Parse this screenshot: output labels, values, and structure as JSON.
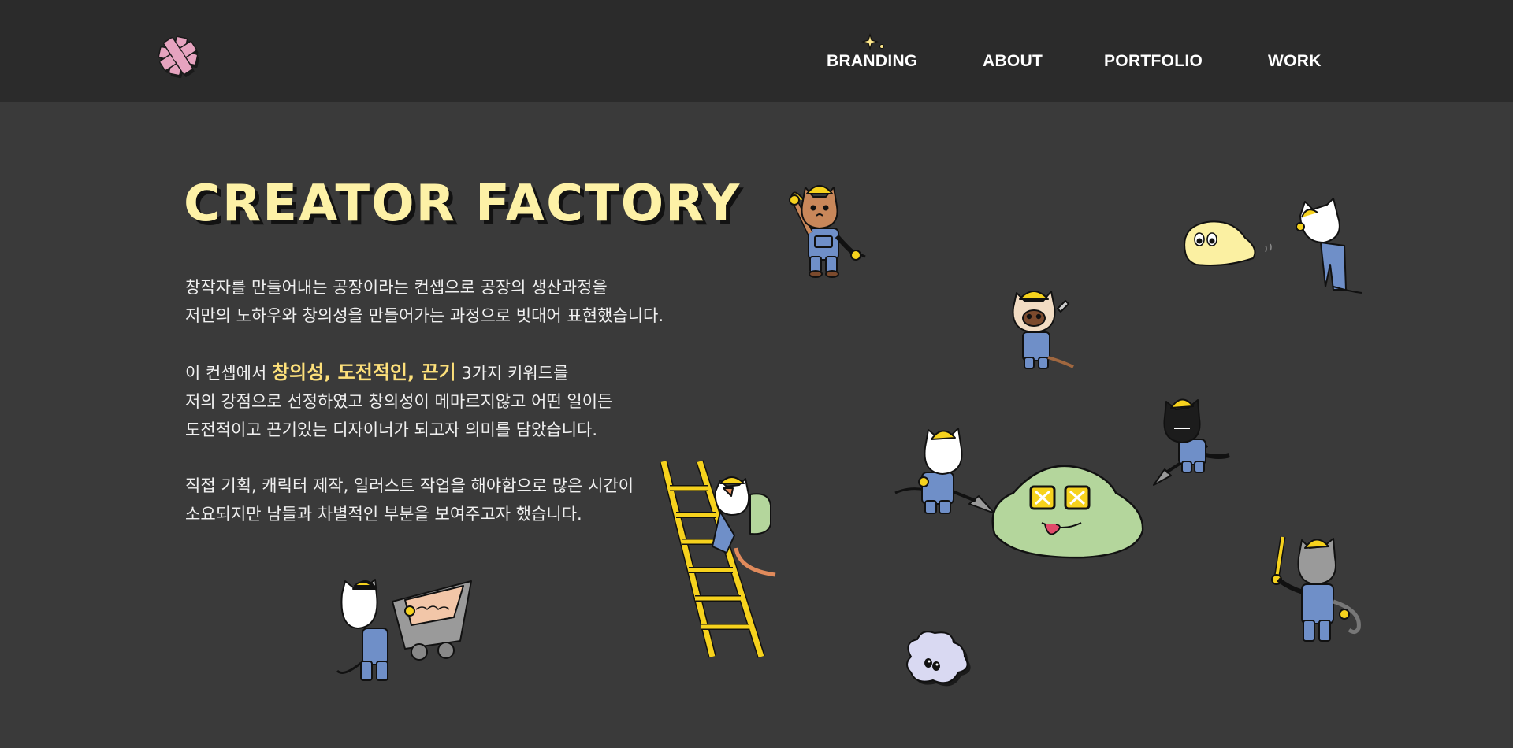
{
  "header": {
    "logo": "pink-asterisk-logo",
    "nav": [
      {
        "label": "BRANDING"
      },
      {
        "label": "ABOUT"
      },
      {
        "label": "PORTFOLIO"
      },
      {
        "label": "WORK"
      }
    ]
  },
  "hero": {
    "title": "CREATOR FACTORY",
    "para1": {
      "line1": "창작자를 만들어내는 공장이라는 컨셉으로 공장의 생산과정을",
      "line2": "저만의 노하우와 창의성을 만들어가는 과정으로 빗대어 표현했습니다."
    },
    "para2": {
      "line1_prefix": "이 컨셉에서",
      "keywords": "창의성, 도전적인, 끈기",
      "line1_suffix": "3가지 키워드를",
      "line2": "저의 강점으로 선정하였고 창의성이 메마르지않고 어떤 일이든",
      "line3": "도전적이고 끈기있는 디자이너가 되고자 의미를 담았습니다."
    },
    "para3": {
      "line1": "직접 기획, 캐릭터 제작, 일러스트 작업을 해야함으로 많은 시간이",
      "line2": "소요되지만 남들과 차별적인 부분을 보여주고자 했습니다."
    }
  },
  "colors": {
    "header_bg": "#2b2b2b",
    "page_bg": "#3a3a3a",
    "title": "#fdf1a6",
    "keyword": "#fde07a",
    "logo_pink": "#e6a3bf",
    "helmet_yellow": "#f6d21d",
    "overalls_blue": "#6f8fc8",
    "green_blob": "#b4d69c",
    "yellow_blob": "#fbf0a2",
    "lavender_blob": "#d9d9f2"
  },
  "illustrations": [
    "cat-worker-waving-icon",
    "yellow-ghost-blob-icon",
    "white-cat-worker-icon",
    "siamese-cat-hammer-icon",
    "black-cat-shovel-icon",
    "white-cat-shovel-icon",
    "green-blob-dizzy-icon",
    "gray-cat-ruler-icon",
    "orange-cat-ladder-icon",
    "cow-cat-wheelbarrow-icon",
    "lavender-blob-icon"
  ]
}
